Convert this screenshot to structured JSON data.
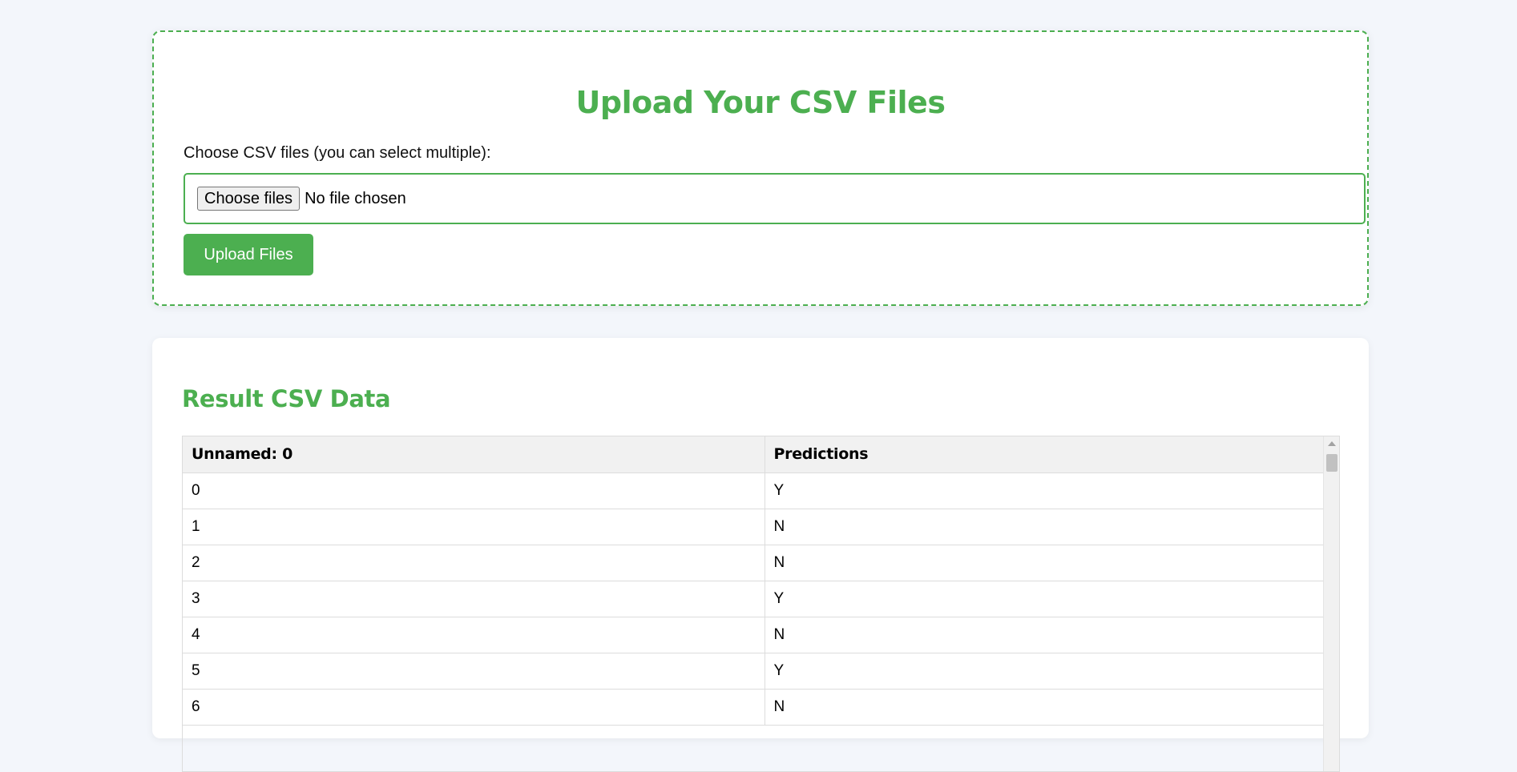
{
  "upload": {
    "title": "Upload Your CSV Files",
    "file_label": "Choose CSV files (you can select multiple):",
    "choose_button": "Choose files",
    "file_status": "No file chosen",
    "upload_button": "Upload Files"
  },
  "result": {
    "title": "Result CSV Data",
    "columns": [
      "Unnamed: 0",
      "Predictions"
    ],
    "rows": [
      [
        "0",
        "Y"
      ],
      [
        "1",
        "N"
      ],
      [
        "2",
        "N"
      ],
      [
        "3",
        "Y"
      ],
      [
        "4",
        "N"
      ],
      [
        "5",
        "Y"
      ],
      [
        "6",
        "N"
      ]
    ]
  },
  "colors": {
    "accent": "#4caf50",
    "background": "#f3f6fb"
  }
}
